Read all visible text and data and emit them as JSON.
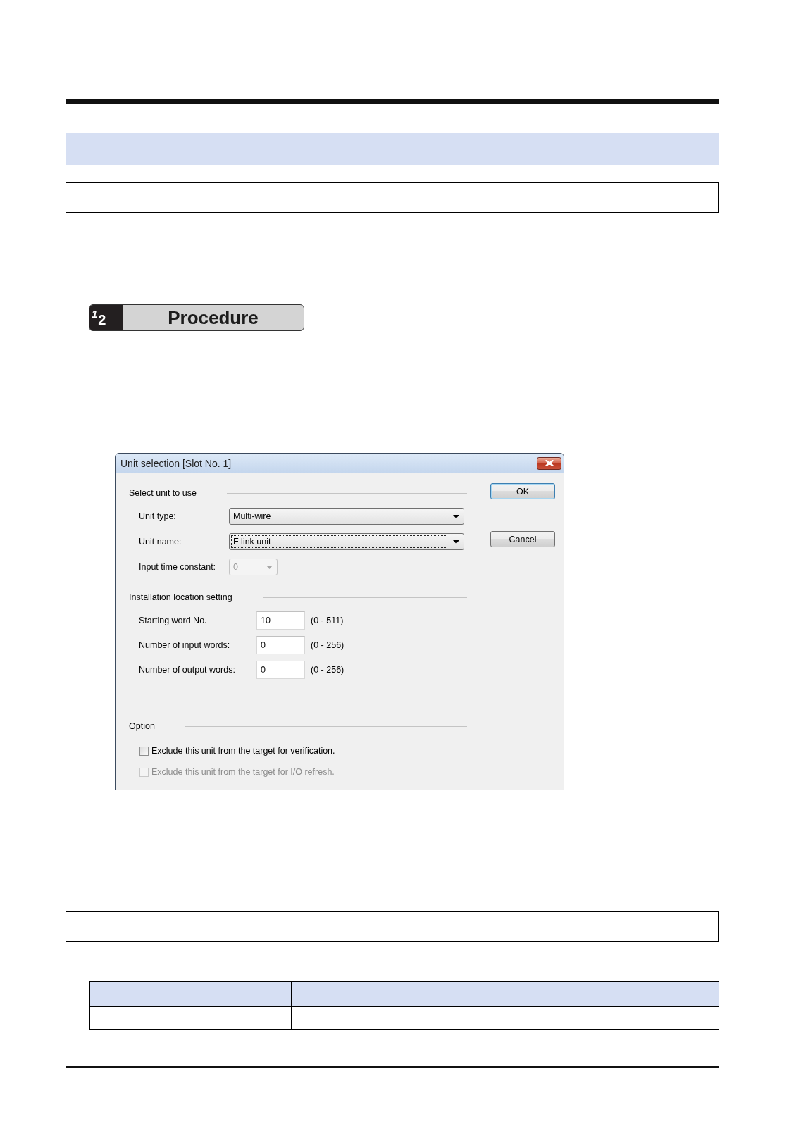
{
  "procedure": {
    "step_digits": [
      "1",
      "2"
    ],
    "title": "Procedure"
  },
  "dialog": {
    "title": "Unit selection [Slot No. 1]",
    "sections": [
      {
        "heading": "Select unit to use",
        "rows": [
          {
            "kind": "combo",
            "label": "Unit type:",
            "value": "Multi-wire",
            "disabled": false,
            "focused": false
          },
          {
            "kind": "combo",
            "label": "Unit name:",
            "value": "F link unit",
            "disabled": false,
            "focused": true
          },
          {
            "kind": "minicombo",
            "label": "Input time constant:",
            "value": "0",
            "disabled": true,
            "focused": false
          }
        ]
      },
      {
        "heading": "Installation location setting",
        "rows": [
          {
            "kind": "number",
            "label": "Starting word No.",
            "value": "10",
            "range": "(0 - 511)",
            "disabled": false,
            "focused": false
          },
          {
            "kind": "number",
            "label": "Number of input words:",
            "value": "0",
            "range": "(0 - 256)",
            "disabled": false,
            "focused": false
          },
          {
            "kind": "number",
            "label": "Number of output words:",
            "value": "0",
            "range": "(0 - 256)",
            "disabled": false,
            "focused": false
          }
        ]
      },
      {
        "heading": "Option",
        "rows": [
          {
            "kind": "checkbox",
            "label": "Exclude this unit from the target for verification.",
            "checked": false,
            "disabled": false,
            "focused": false
          },
          {
            "kind": "checkbox",
            "label": "Exclude this unit from the target for I/O refresh.",
            "checked": false,
            "disabled": true,
            "focused": false
          }
        ]
      }
    ],
    "buttons": [
      {
        "label": "OK",
        "default": true
      },
      {
        "label": "Cancel",
        "default": false
      }
    ]
  }
}
